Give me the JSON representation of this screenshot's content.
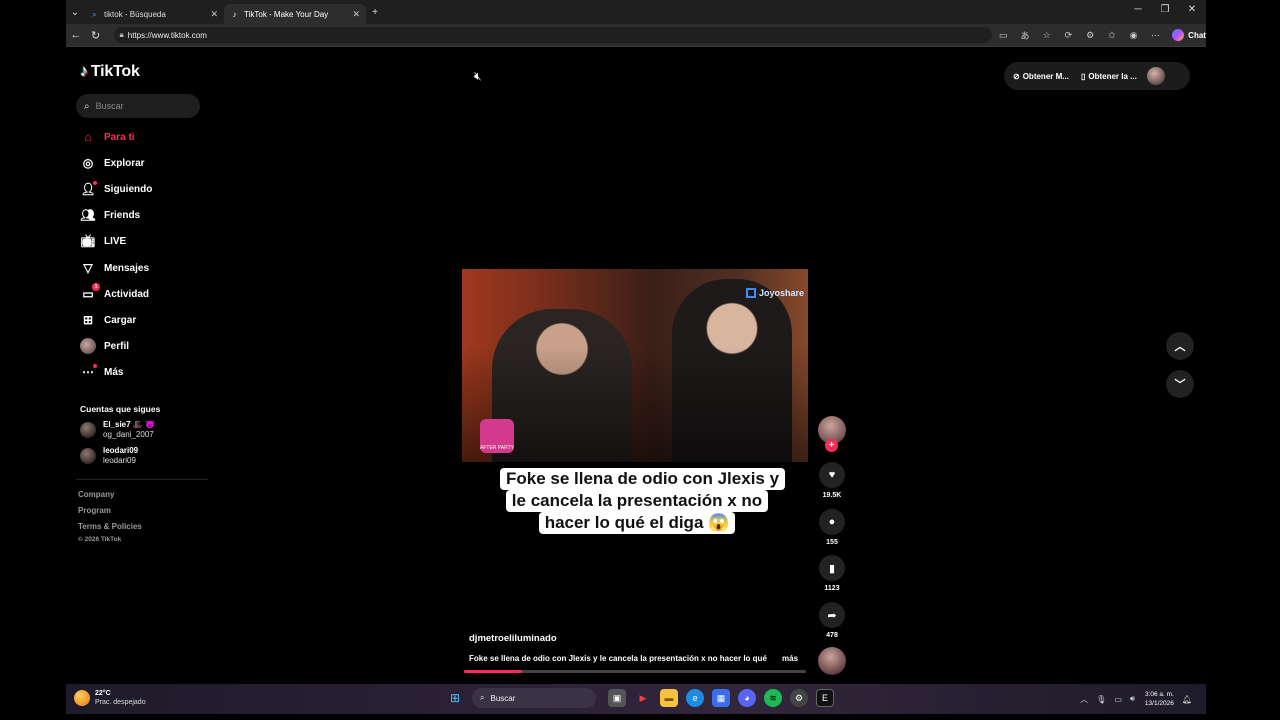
{
  "browser": {
    "tabs": [
      {
        "title": "tiktok - Búsqueda",
        "icon": "search-icon",
        "active": false
      },
      {
        "title": "TikTok - Make Your Day",
        "icon": "tiktok-icon",
        "active": true
      }
    ],
    "url": "https://www.tiktok.com",
    "chat_label": "Chat"
  },
  "sidebar": {
    "logo_text": "TikTok",
    "search_placeholder": "Buscar",
    "items": [
      {
        "label": "Para ti",
        "icon": "home-icon",
        "active": true
      },
      {
        "label": "Explorar",
        "icon": "compass-icon"
      },
      {
        "label": "Siguiendo",
        "icon": "following-icon"
      },
      {
        "label": "Friends",
        "icon": "friends-icon"
      },
      {
        "label": "LIVE",
        "icon": "live-tv-icon"
      },
      {
        "label": "Mensajes",
        "icon": "messages-icon"
      },
      {
        "label": "Actividad",
        "icon": "activity-icon",
        "badge": "1"
      },
      {
        "label": "Cargar",
        "icon": "upload-icon"
      },
      {
        "label": "Perfil",
        "icon": "profile-avatar"
      },
      {
        "label": "Más",
        "icon": "more-icon"
      }
    ],
    "following_title": "Cuentas que sigues",
    "following": [
      {
        "name": "El_sie7 🎩 😈",
        "handle": "og_dani_2007"
      },
      {
        "name": "leodari09",
        "handle": "leodari09"
      }
    ],
    "footer_links": [
      "Company",
      "Program",
      "Terms & Policies"
    ],
    "copyright": "© 2026 TikTok"
  },
  "topbar": {
    "get_coins_label": "Obtener M...",
    "get_app_label": "Obtener la ..."
  },
  "video": {
    "watermark": "Joyoshare",
    "caption_lines": [
      "Foke se llena de odio con Jlexis y",
      "le cancela la presentación x no",
      "hacer lo qué el diga 😱"
    ],
    "author": "djmetroeliluminado",
    "description": "Foke se llena de odio con Jlexis y le cancela la presentación x no hacer lo qué",
    "more_label": "más",
    "progress": 0.17,
    "logo_badge": "AFTER PARTY"
  },
  "actions": {
    "likes": "19.5K",
    "comments": "155",
    "saves": "1123",
    "shares": "478"
  },
  "taskbar": {
    "temperature": "22°C",
    "condition": "Prac. despejado",
    "search_placeholder": "Buscar",
    "time": "3:06 a. m.",
    "date": "13/1/2026"
  },
  "colors": {
    "accent": "#fe2c55",
    "background": "#000000"
  }
}
